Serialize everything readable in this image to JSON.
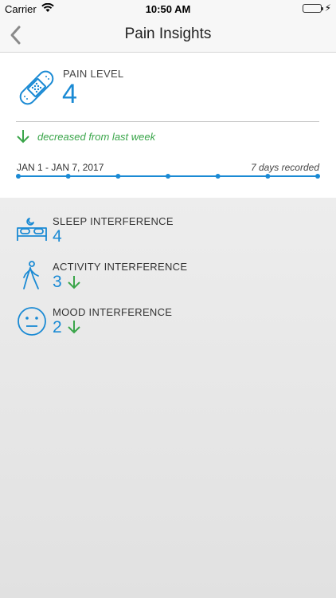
{
  "status_bar": {
    "carrier": "Carrier",
    "time": "10:50 AM"
  },
  "nav": {
    "title": "Pain Insights"
  },
  "pain": {
    "label": "PAIN LEVEL",
    "value": "4",
    "trend_text": "decreased from last week",
    "trend": "down"
  },
  "timeline": {
    "date_range": "JAN 1 - JAN 7, 2017",
    "days_recorded": "7 days recorded",
    "points": 7
  },
  "interferences": [
    {
      "label": "SLEEP INTERFERENCE",
      "value": "4",
      "icon": "bed-icon",
      "trend": "none"
    },
    {
      "label": "ACTIVITY INTERFERENCE",
      "value": "3",
      "icon": "walking-person-icon",
      "trend": "down"
    },
    {
      "label": "MOOD INTERFERENCE",
      "value": "2",
      "icon": "neutral-face-icon",
      "trend": "down"
    }
  ],
  "colors": {
    "accent": "#1a8ad4",
    "trend_down": "#3aa54a"
  }
}
